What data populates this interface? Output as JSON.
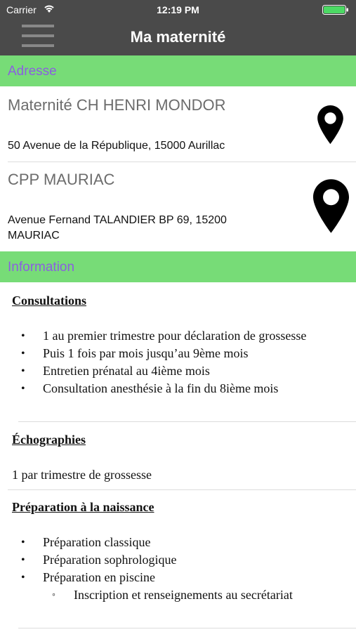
{
  "status_bar": {
    "carrier": "Carrier",
    "time": "12:19 PM",
    "battery_color": "#4cd964"
  },
  "nav": {
    "title": "Ma maternité",
    "menu_icon": "hamburger-menu-icon"
  },
  "sections": {
    "address_header": "Adresse",
    "information_header": "Information"
  },
  "addresses": [
    {
      "name": "Maternité CH HENRI MONDOR",
      "street": "50 Avenue de la République, 15000 Aurillac",
      "icon": "map-pin-icon"
    },
    {
      "name": "CPP MAURIAC",
      "street": "Avenue Fernand TALANDIER BP 69, 15200 MAURIAC",
      "icon": "map-pin-icon"
    }
  ],
  "information": {
    "consultations": {
      "heading": "Consultations",
      "items": [
        "1 au premier trimestre pour déclaration de grossesse",
        "Puis 1 fois par mois jusqu’au 9ème mois",
        "Entretien prénatal au 4ième mois",
        "Consultation anesthésie à la fin du 8ième mois"
      ]
    },
    "echographies": {
      "heading": "Échographies",
      "text": "1 par trimestre de grossesse"
    },
    "preparation": {
      "heading": "Préparation à la naissance",
      "items": [
        "Préparation classique",
        "Préparation sophrologique",
        "Préparation en piscine"
      ],
      "sub_items": [
        "Inscription et renseignements au secrétariat"
      ]
    }
  },
  "colors": {
    "nav_background": "#4a4a4a",
    "section_background": "#77dc77",
    "section_text": "#8b5fe0"
  }
}
